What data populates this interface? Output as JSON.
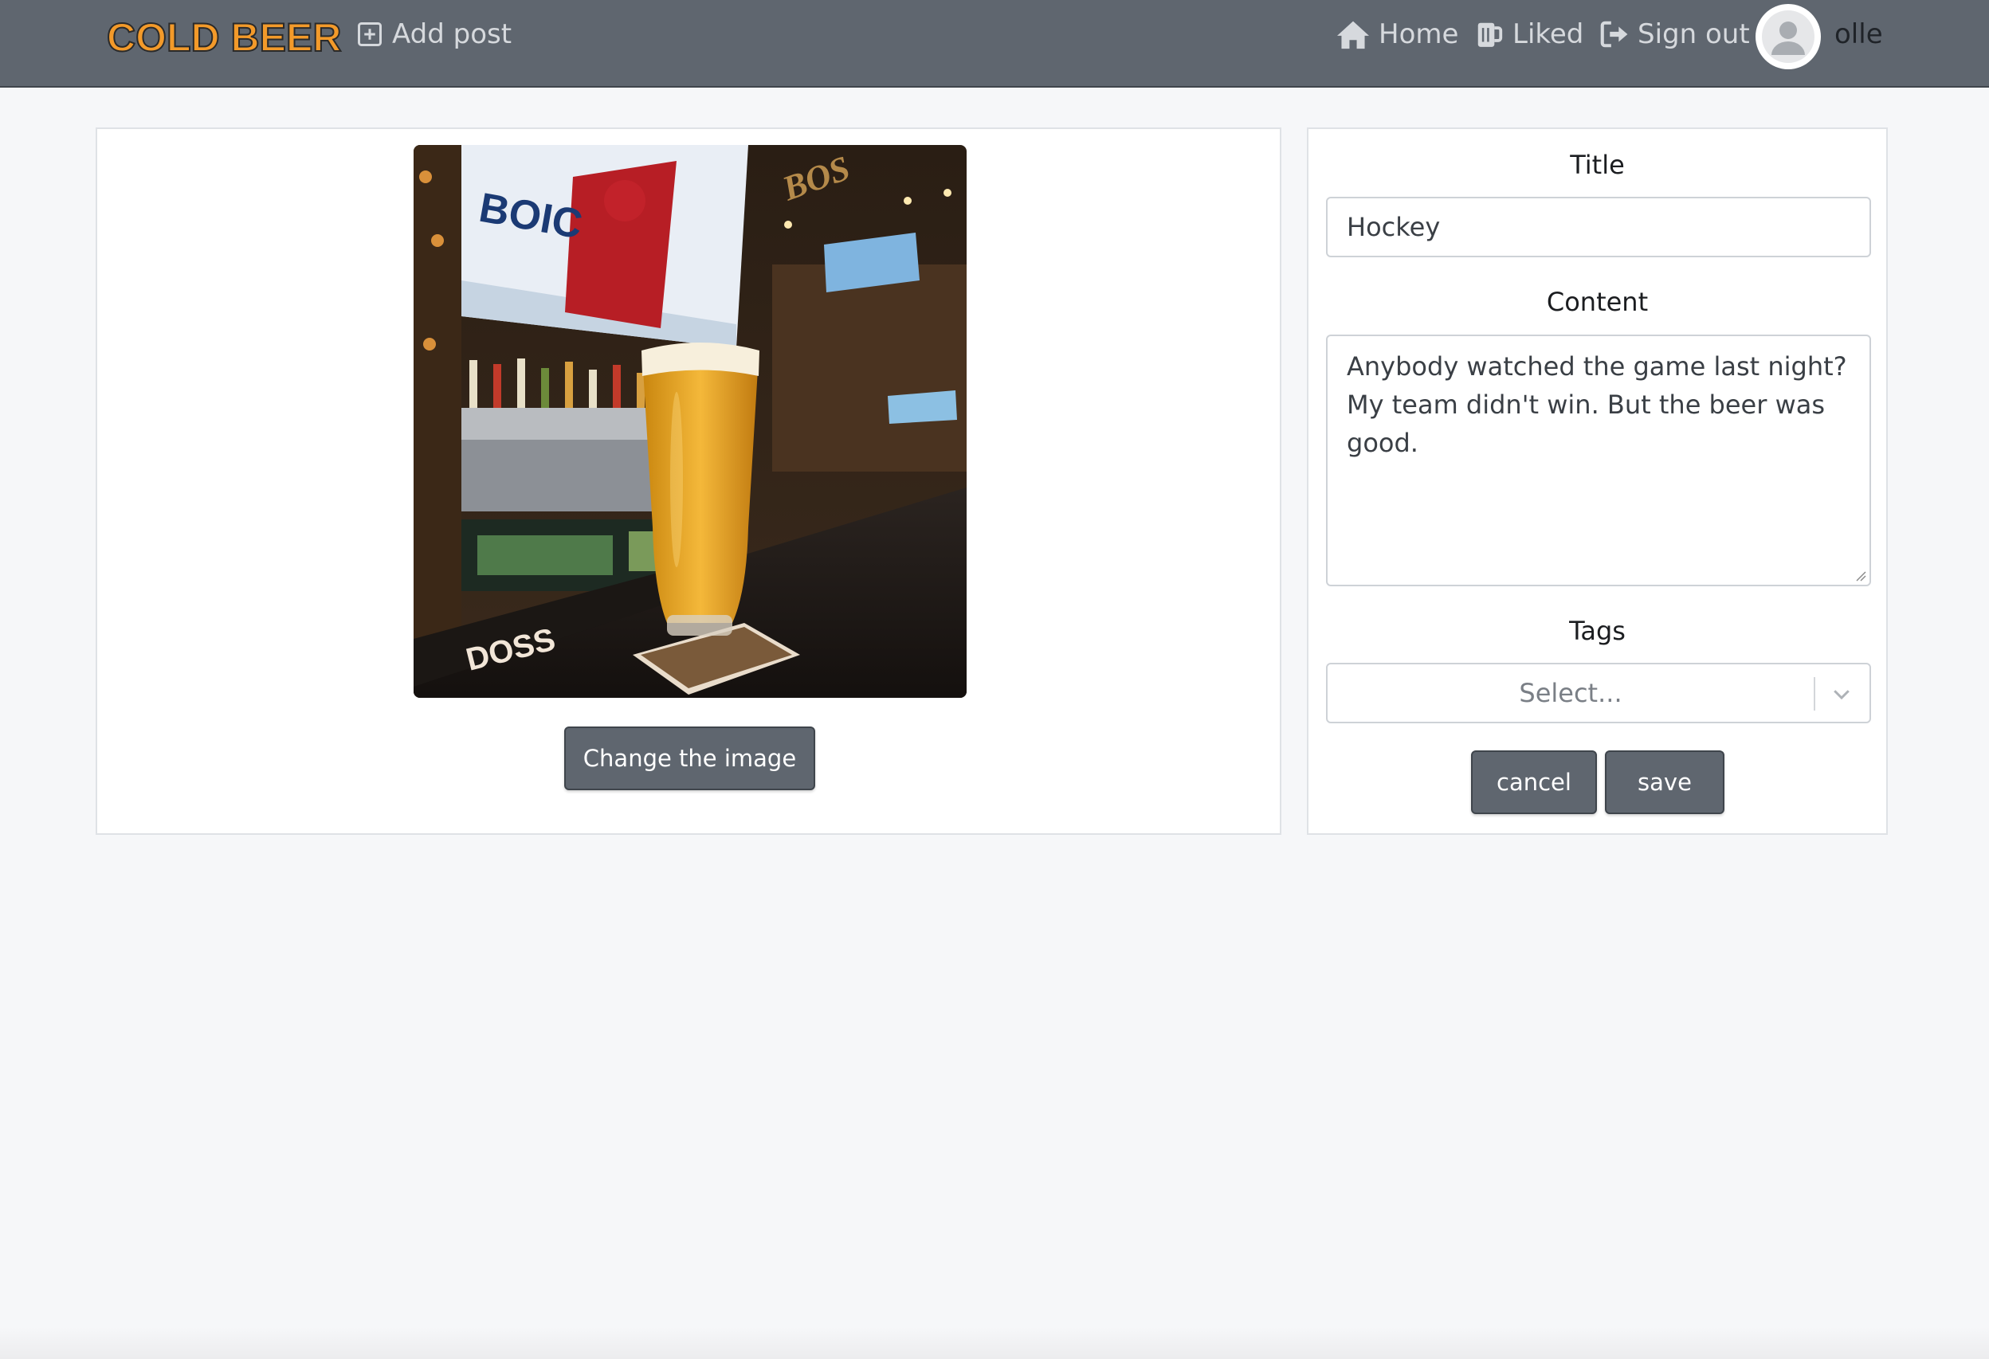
{
  "nav": {
    "brand": "COLD BEER",
    "add_post": "Add post",
    "home": "Home",
    "liked": "Liked",
    "sign_out": "Sign out",
    "username": "olle"
  },
  "image_card": {
    "change_image_label": "Change the image"
  },
  "form": {
    "title_label": "Title",
    "title_value": "Hockey",
    "content_label": "Content",
    "content_value": "Anybody watched the game last night? My team didn't win. But the beer was good.",
    "tags_label": "Tags",
    "tags_placeholder": "Select...",
    "cancel_label": "cancel",
    "save_label": "save"
  },
  "colors": {
    "navbar": "#5f666f",
    "brand": "#f39a2a",
    "button": "#5f666f",
    "background": "#f6f7f9"
  },
  "icons": [
    "plus-square-icon",
    "home-icon",
    "beer-mug-icon",
    "sign-out-icon",
    "user-avatar-icon",
    "chevron-down-icon"
  ]
}
